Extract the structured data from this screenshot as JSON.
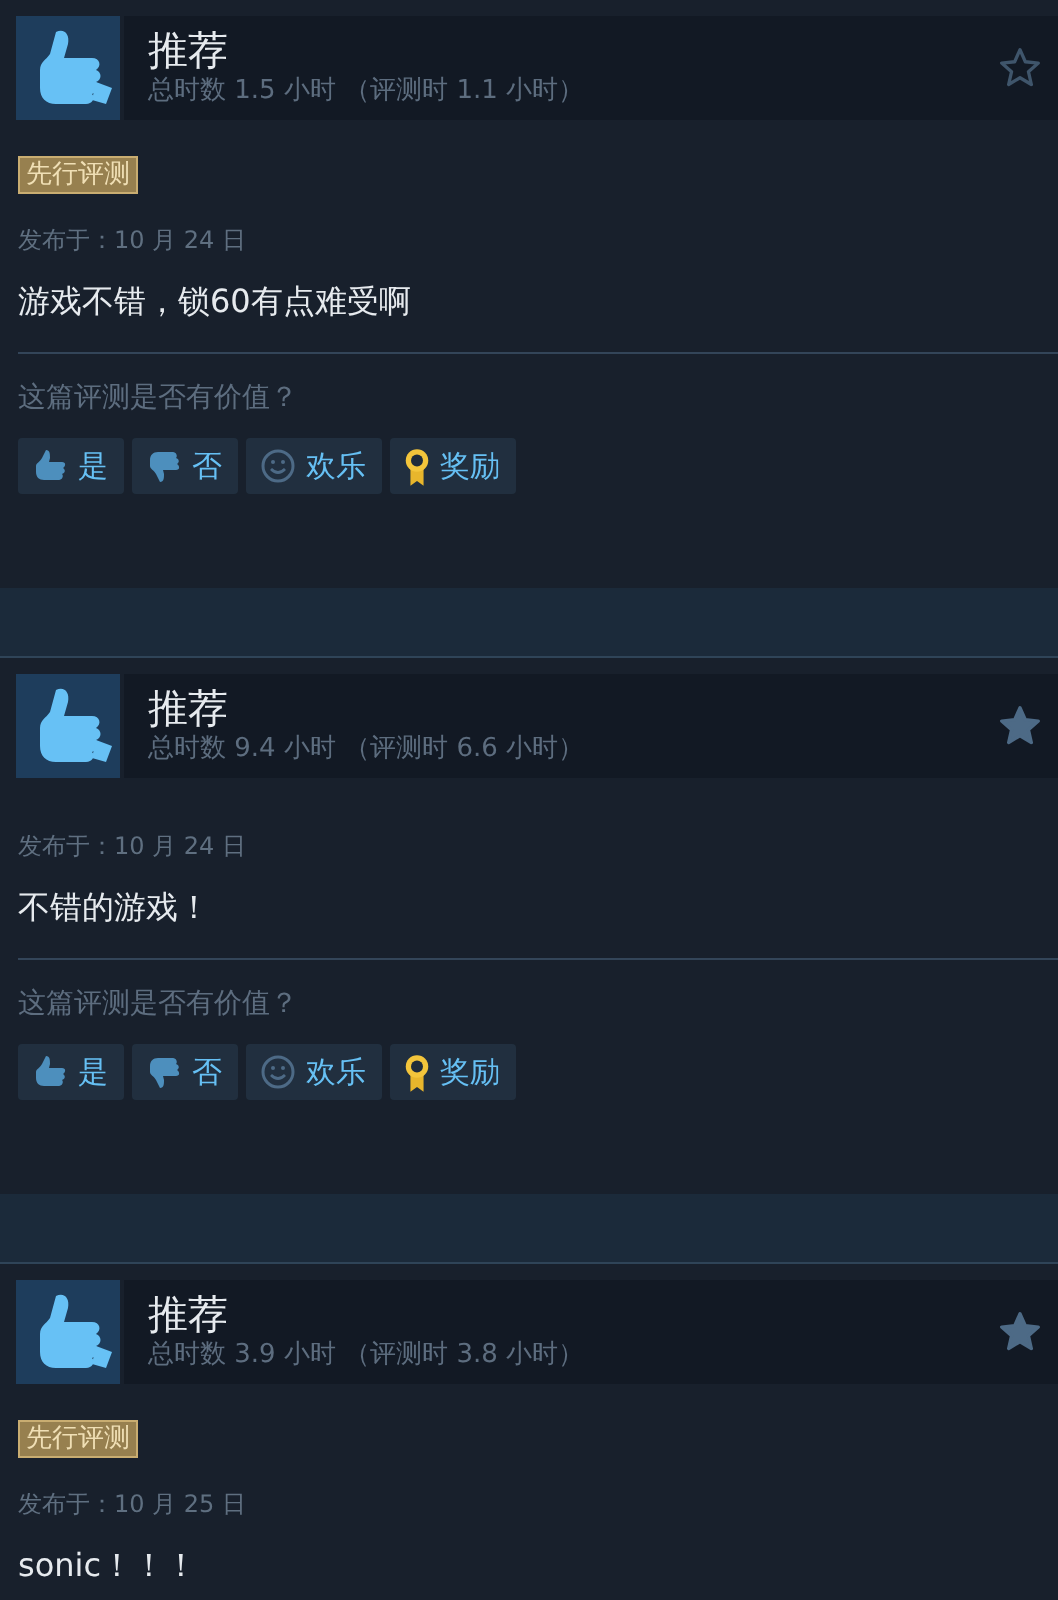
{
  "reviews": [
    {
      "verdict": "推荐",
      "hours": "总时数 1.5 小时 （评测时 1.1 小时）",
      "starred": false,
      "badge": "先行评测",
      "date": "发布于：10 月 24 日",
      "text": "游戏不错，锁60有点难受啊",
      "helpful": {
        "question": "这篇评测是否有价值？",
        "buttons": [
          {
            "kind": "yes",
            "label": "是"
          },
          {
            "kind": "no",
            "label": "否"
          },
          {
            "kind": "funny",
            "label": "欢乐"
          },
          {
            "kind": "award",
            "label": "奖励"
          }
        ]
      }
    },
    {
      "verdict": "推荐",
      "hours": "总时数 9.4 小时 （评测时 6.6 小时）",
      "starred": true,
      "date": "发布于：10 月 24 日",
      "text": "不错的游戏！",
      "helpful": {
        "question": "这篇评测是否有价值？",
        "buttons": [
          {
            "kind": "yes",
            "label": "是"
          },
          {
            "kind": "no",
            "label": "否"
          },
          {
            "kind": "funny",
            "label": "欢乐"
          },
          {
            "kind": "award",
            "label": "奖励"
          }
        ]
      }
    },
    {
      "verdict": "推荐",
      "hours": "总时数 3.9 小时 （评测时 3.8 小时）",
      "starred": true,
      "badge": "先行评测",
      "date": "发布于：10 月 25 日",
      "text": "sonic！！！"
    }
  ]
}
